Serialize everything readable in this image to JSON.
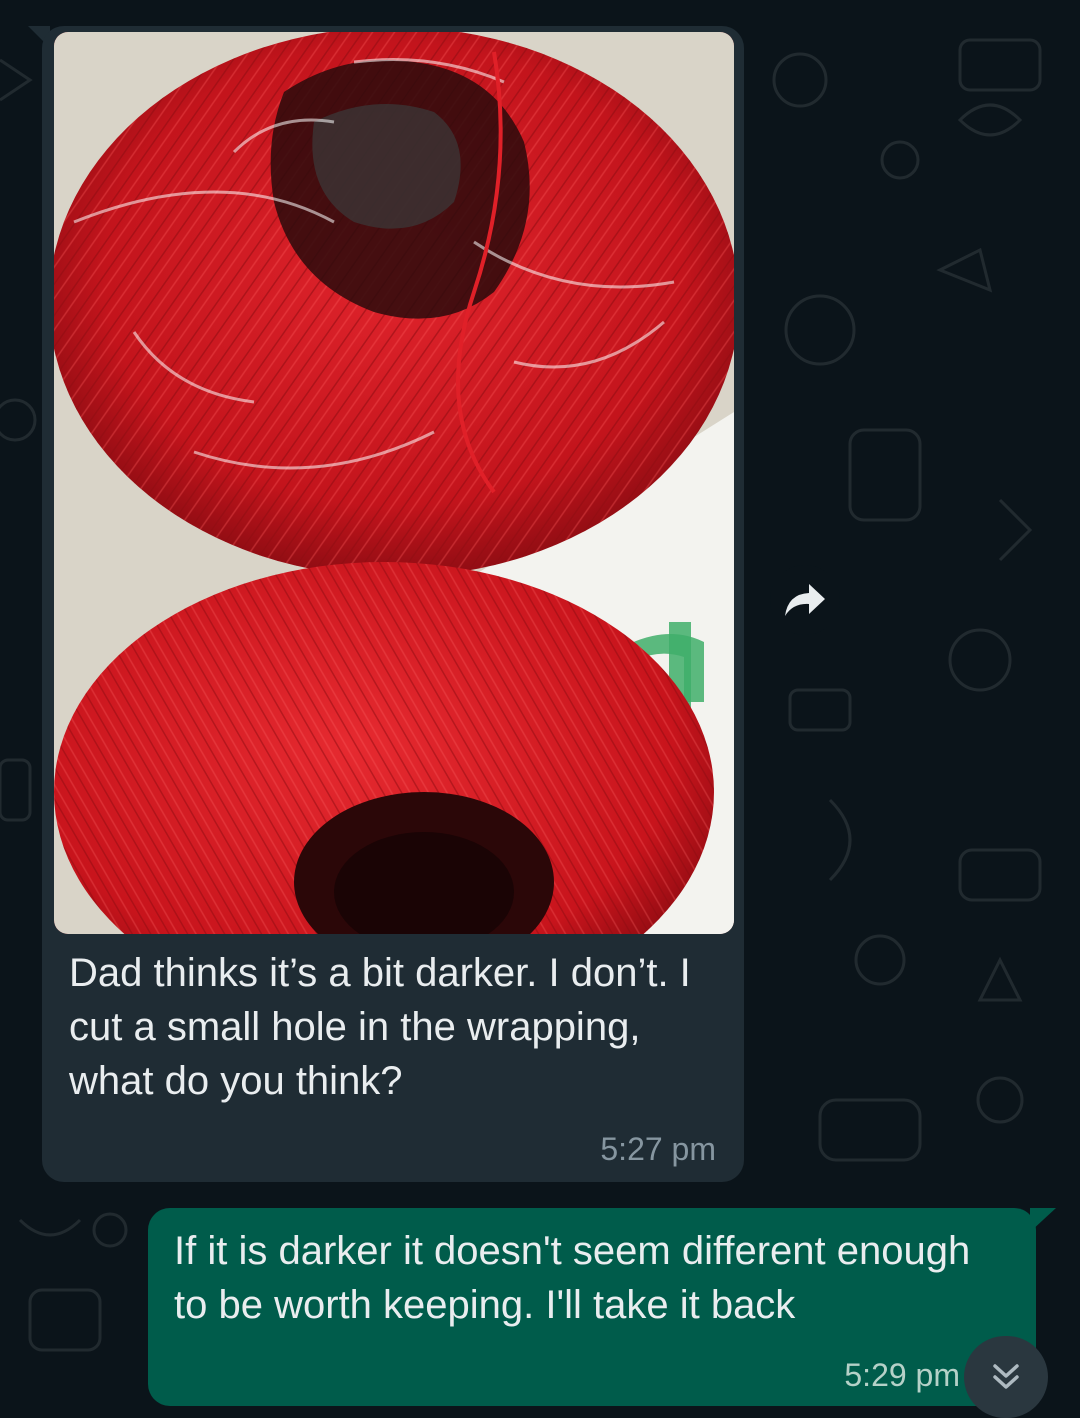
{
  "colors": {
    "chat_background": "#0b141a",
    "incoming_bubble": "#1f2c34",
    "outgoing_bubble": "#005c4b",
    "text": "#e9edef",
    "timestamp_in": "#8696a0"
  },
  "incoming_message": {
    "image_description_icon": "yarn-photo",
    "caption": "Dad thinks it’s a bit darker. I don’t. I cut a small hole in the wrapping, what do you think?",
    "time": "5:27 pm",
    "forward_icon": "forward-arrow-icon"
  },
  "outgoing_message": {
    "text": "If it is darker it doesn't seem different enough to be worth keeping. I'll take it back",
    "time": "5:29 pm"
  },
  "scroll_down_icon": "double-chevron-down-icon"
}
